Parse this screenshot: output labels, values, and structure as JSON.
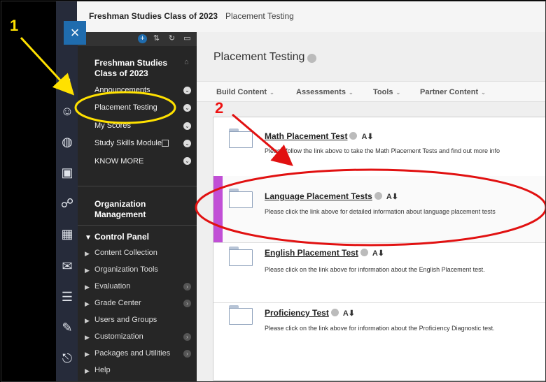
{
  "breadcrumb": {
    "course": "Freshman Studies Class of 2023",
    "page": "Placement Testing"
  },
  "close_button": {
    "label": "×"
  },
  "course_menu": {
    "title": "Freshman Studies Class of 2023",
    "items": [
      {
        "label": "Announcements"
      },
      {
        "label": "Placement Testing"
      },
      {
        "label": "My Scores"
      },
      {
        "label": "Study Skills Module"
      },
      {
        "label": "KNOW MORE"
      }
    ],
    "org_management": "Organization Management",
    "control_panel": "Control Panel",
    "control_items": [
      {
        "label": "Content Collection"
      },
      {
        "label": "Organization Tools"
      },
      {
        "label": "Evaluation"
      },
      {
        "label": "Grade Center"
      },
      {
        "label": "Users and Groups"
      },
      {
        "label": "Customization"
      },
      {
        "label": "Packages and Utilities"
      },
      {
        "label": "Help"
      }
    ]
  },
  "main": {
    "title": "Placement Testing",
    "toolbar": [
      {
        "label": "Build Content"
      },
      {
        "label": "Assessments"
      },
      {
        "label": "Tools"
      },
      {
        "label": "Partner Content"
      }
    ],
    "items": [
      {
        "title": "Math Placement Test",
        "description": "Please follow the link above to take the Math Placement Tests and find out more info"
      },
      {
        "title": "Language Placement Tests",
        "description": "Please click the link above for detailed information about language placement tests"
      },
      {
        "title": "English Placement Test",
        "description": "Please click on the link above for information about the English Placement test."
      },
      {
        "title": "Proficiency Test",
        "description": "Please click on the link above for information about the Proficiency Diagnostic test."
      }
    ]
  },
  "annotations": {
    "step1": "1",
    "step2": "2"
  },
  "icons": [
    "close-icon",
    "home-icon",
    "user-icon",
    "globe-icon",
    "calendar-icon",
    "mail-icon",
    "people-icon",
    "edit-icon",
    "logout-icon",
    "folder-icon",
    "chevron-down-icon",
    "adaptive-release-icon"
  ],
  "colors": {
    "accent": "#1f6cae",
    "menu_bg": "#262626",
    "highlight": "#c14fd6",
    "annotation_yellow": "#ffe100",
    "annotation_red": "#e11111"
  }
}
